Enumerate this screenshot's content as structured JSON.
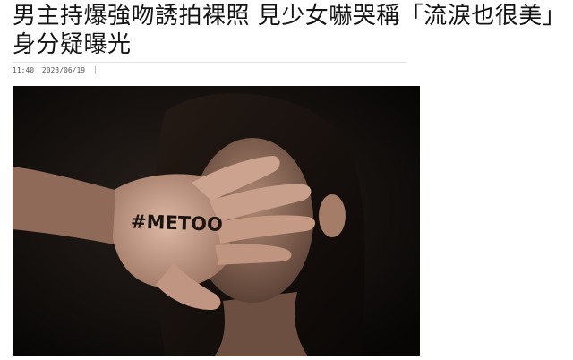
{
  "article": {
    "headline": "男主持爆強吻誘拍裸照 見少女嚇哭稱「流淚也很美」身分疑曝光",
    "time": "11:40",
    "date": "2023/06/19"
  },
  "photo": {
    "hand_text": "#METOO"
  }
}
